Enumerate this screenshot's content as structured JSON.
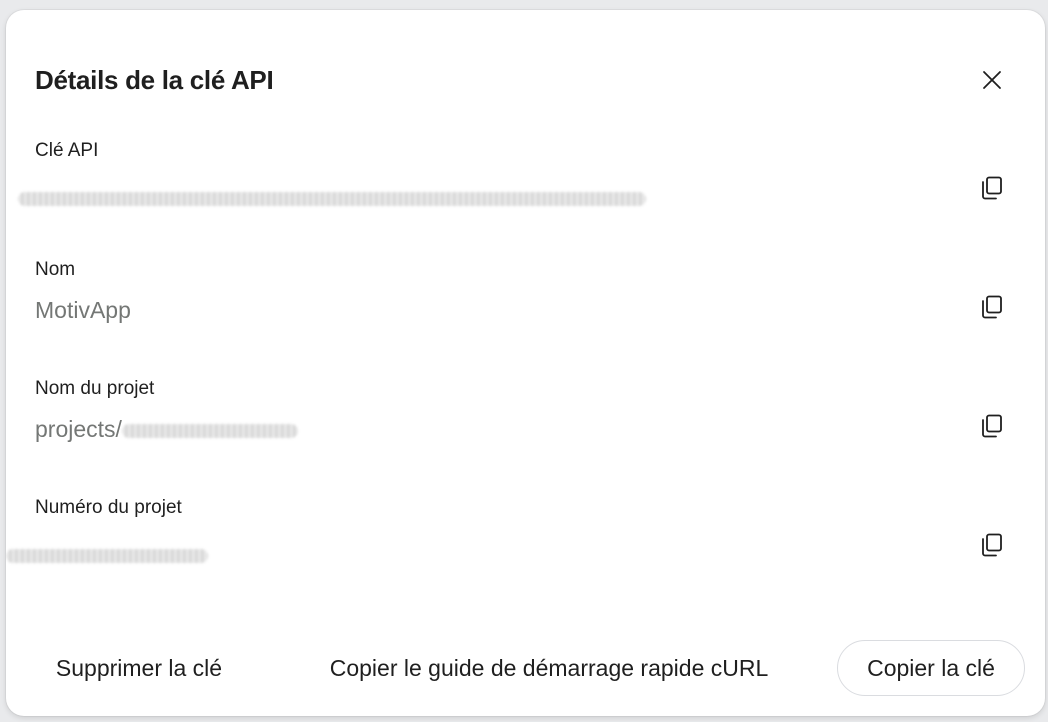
{
  "dialog": {
    "title": "Détails de la clé API",
    "close_icon": "close-icon"
  },
  "fields": {
    "api_key": {
      "label": "Clé API",
      "value": "",
      "redacted": true,
      "copy_icon": "copy-icon"
    },
    "name": {
      "label": "Nom",
      "value": "MotivApp",
      "copy_icon": "copy-icon"
    },
    "project_name": {
      "label": "Nom du projet",
      "value_prefix": "projects/",
      "redacted": true,
      "copy_icon": "copy-icon"
    },
    "project_number": {
      "label": "Numéro du projet",
      "value": "",
      "redacted": true,
      "copy_icon": "copy-icon"
    }
  },
  "footer": {
    "delete_label": "Supprimer la clé",
    "curl_label": "Copier le guide de démarrage rapide cURL",
    "copy_key_label": "Copier la clé"
  },
  "colors": {
    "text_primary": "#1f1f1f",
    "text_secondary": "#747775",
    "border": "#dadce0"
  }
}
